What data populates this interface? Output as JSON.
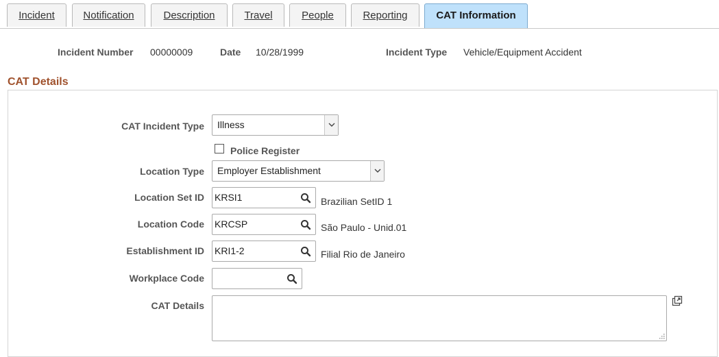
{
  "tabs": [
    {
      "label": "Incident",
      "active": false
    },
    {
      "label": "Notification",
      "active": false
    },
    {
      "label": "Description",
      "active": false
    },
    {
      "label": "Travel",
      "active": false
    },
    {
      "label": "People",
      "active": false
    },
    {
      "label": "Reporting",
      "active": false
    },
    {
      "label": "CAT Information",
      "active": true
    }
  ],
  "header": {
    "incident_number_label": "Incident Number",
    "incident_number": "00000009",
    "date_label": "Date",
    "date": "10/28/1999",
    "incident_type_label": "Incident Type",
    "incident_type": "Vehicle/Equipment Accident"
  },
  "section": {
    "title": "CAT Details"
  },
  "form": {
    "cat_incident_type_label": "CAT Incident Type",
    "cat_incident_type": "Illness",
    "police_register_label": "Police Register",
    "police_register_checked": false,
    "location_type_label": "Location Type",
    "location_type": "Employer Establishment",
    "location_set_id_label": "Location Set ID",
    "location_set_id": "KRSI1",
    "location_set_id_desc": "Brazilian SetID 1",
    "location_code_label": "Location Code",
    "location_code": "KRCSP",
    "location_code_desc": "São Paulo - Unid.01",
    "establishment_id_label": "Establishment ID",
    "establishment_id": "KRI1-2",
    "establishment_id_desc": "Filial Rio de Janeiro",
    "workplace_code_label": "Workplace Code",
    "workplace_code": "",
    "cat_details_label": "CAT Details",
    "cat_details": ""
  },
  "icons": {
    "lookup": "search-icon",
    "dropdown": "chevron-down-icon",
    "expand": "expand-icon"
  },
  "colors": {
    "active_tab": "#bfe1fb",
    "section_title": "#a0522d"
  }
}
